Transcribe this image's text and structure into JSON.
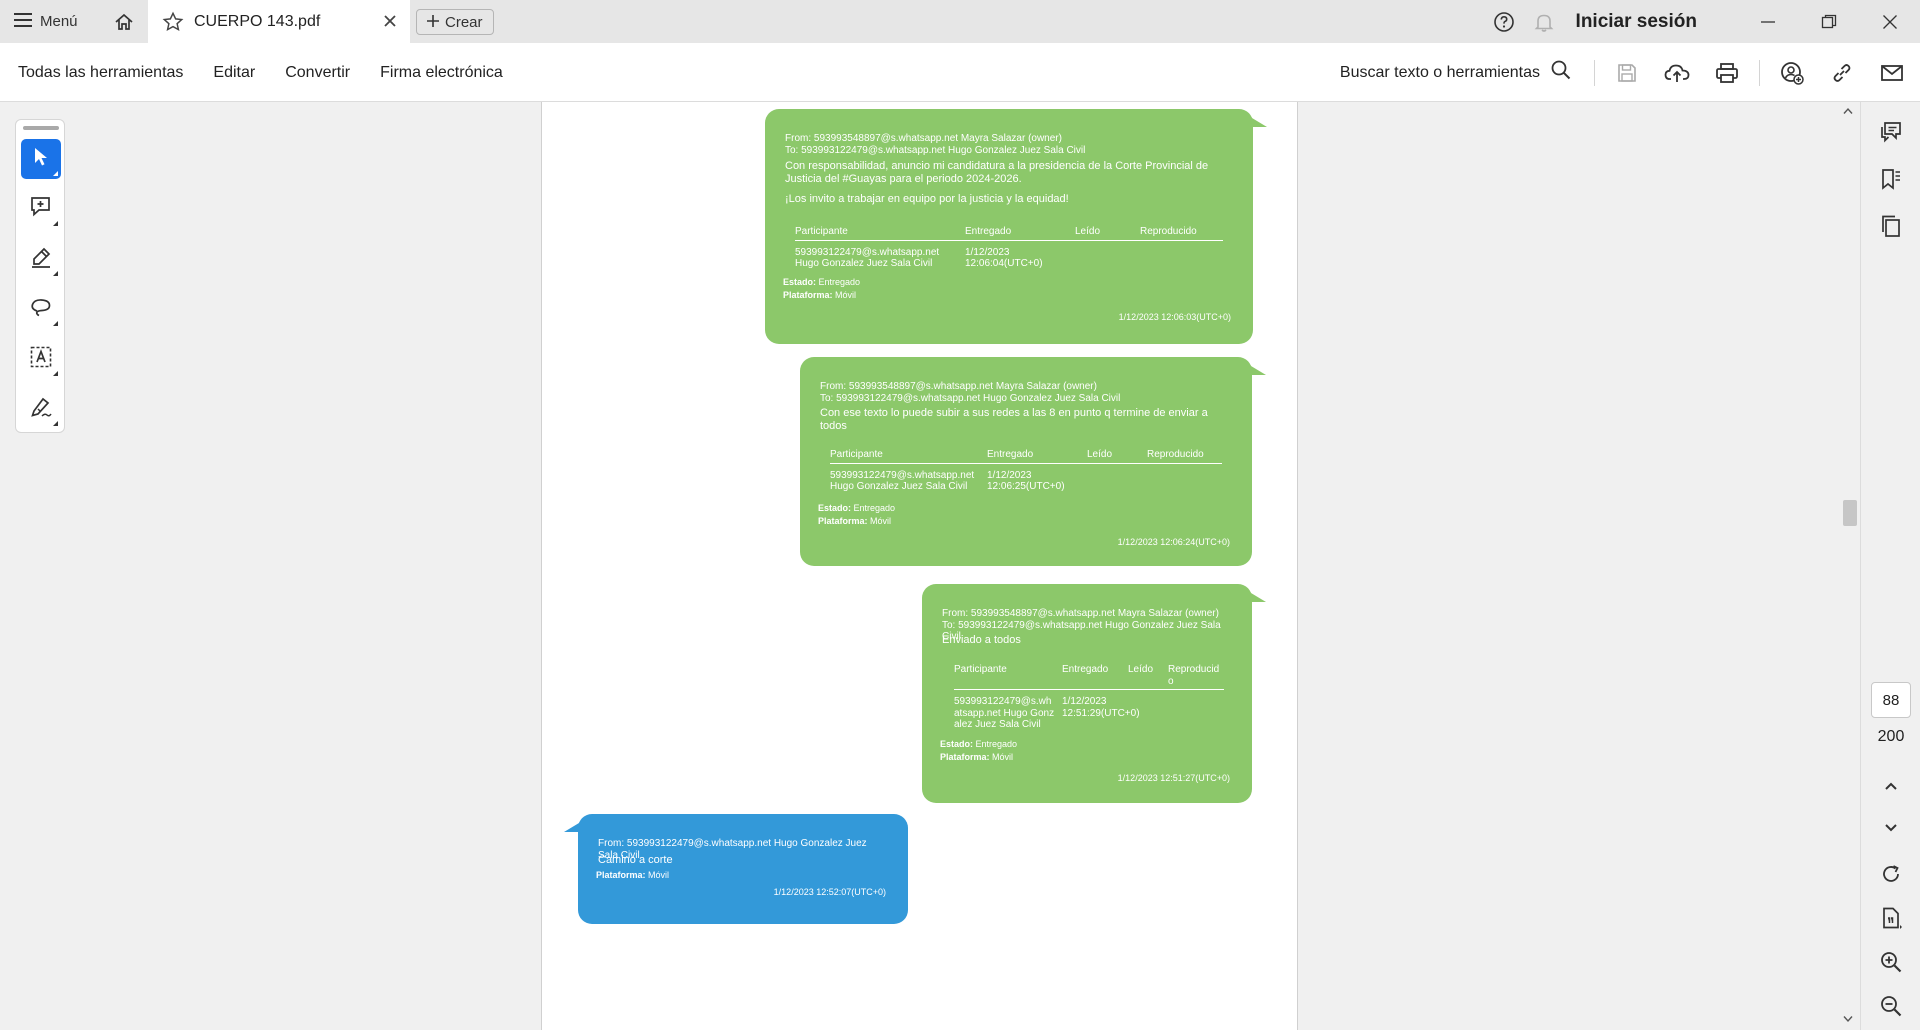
{
  "titlebar": {
    "menu_label": "Menú",
    "tab_title": "CUERPO 143.pdf",
    "create_label": "Crear",
    "signin_label": "Iniciar sesión"
  },
  "toolbar": {
    "menu_items": [
      "Todas las herramientas",
      "Editar",
      "Convertir",
      "Firma electrónica"
    ],
    "search_label": "Buscar texto o herramientas"
  },
  "messages": [
    {
      "header_from": "From: 593993548897@s.whatsapp.net Mayra Salazar (owner)",
      "header_to": "To: 593993122479@s.whatsapp.net Hugo Gonzalez Juez Sala Civil",
      "body": "Con responsabilidad, anuncio mi candidatura a la presidencia de la Corte Provincial de Justicia del #Guayas para el periodo 2024-2026.",
      "body2": "¡Los invito a trabajar en equipo por la justicia y la equidad!",
      "table_headers": [
        "Participante",
        "Entregado",
        "Leído",
        "Reproducido"
      ],
      "participant": "593993122479@s.whatsapp.net Hugo Gonzalez Juez Sala Civil",
      "delivered": "1/12/2023 12:06:04(UTC+0)",
      "estado_label": "Estado:",
      "estado_value": "Entregado",
      "plataforma_label": "Plataforma:",
      "plataforma_value": "Móvil",
      "timestamp": "1/12/2023 12:06:03(UTC+0)"
    },
    {
      "header_from": "From: 593993548897@s.whatsapp.net Mayra Salazar (owner)",
      "header_to": "To: 593993122479@s.whatsapp.net Hugo Gonzalez Juez Sala Civil",
      "body": "Con ese texto lo puede subir a sus redes a las 8 en punto q termine de enviar a todos",
      "table_headers": [
        "Participante",
        "Entregado",
        "Leído",
        "Reproducido"
      ],
      "participant": "593993122479@s.whatsapp.net Hugo Gonzalez Juez Sala Civil",
      "delivered": "1/12/2023 12:06:25(UTC+0)",
      "estado_label": "Estado:",
      "estado_value": "Entregado",
      "plataforma_label": "Plataforma:",
      "plataforma_value": "Móvil",
      "timestamp": "1/12/2023 12:06:24(UTC+0)"
    },
    {
      "header_from": "From: 593993548897@s.whatsapp.net Mayra Salazar (owner)",
      "header_to": "To: 593993122479@s.whatsapp.net Hugo Gonzalez Juez Sala Civil",
      "body": "Enviado a todos",
      "table_headers": [
        "Participante",
        "Entregado",
        "Leído",
        "Reproducido"
      ],
      "participant": "593993122479@s.whatsapp.net Hugo Gonzalez Juez Sala Civil",
      "delivered": "1/12/2023 12:51:29(UTC+0)",
      "estado_label": "Estado:",
      "estado_value": "Entregado",
      "plataforma_label": "Plataforma:",
      "plataforma_value": "Móvil",
      "timestamp": "1/12/2023 12:51:27(UTC+0)"
    },
    {
      "header_from": "From: 593993122479@s.whatsapp.net Hugo Gonzalez Juez Sala Civil",
      "body": "Camino a corte",
      "plataforma_label": "Plataforma:",
      "plataforma_value": "Móvil",
      "timestamp": "1/12/2023 12:52:07(UTC+0)"
    }
  ],
  "pagination": {
    "current": "88",
    "total": "200"
  }
}
